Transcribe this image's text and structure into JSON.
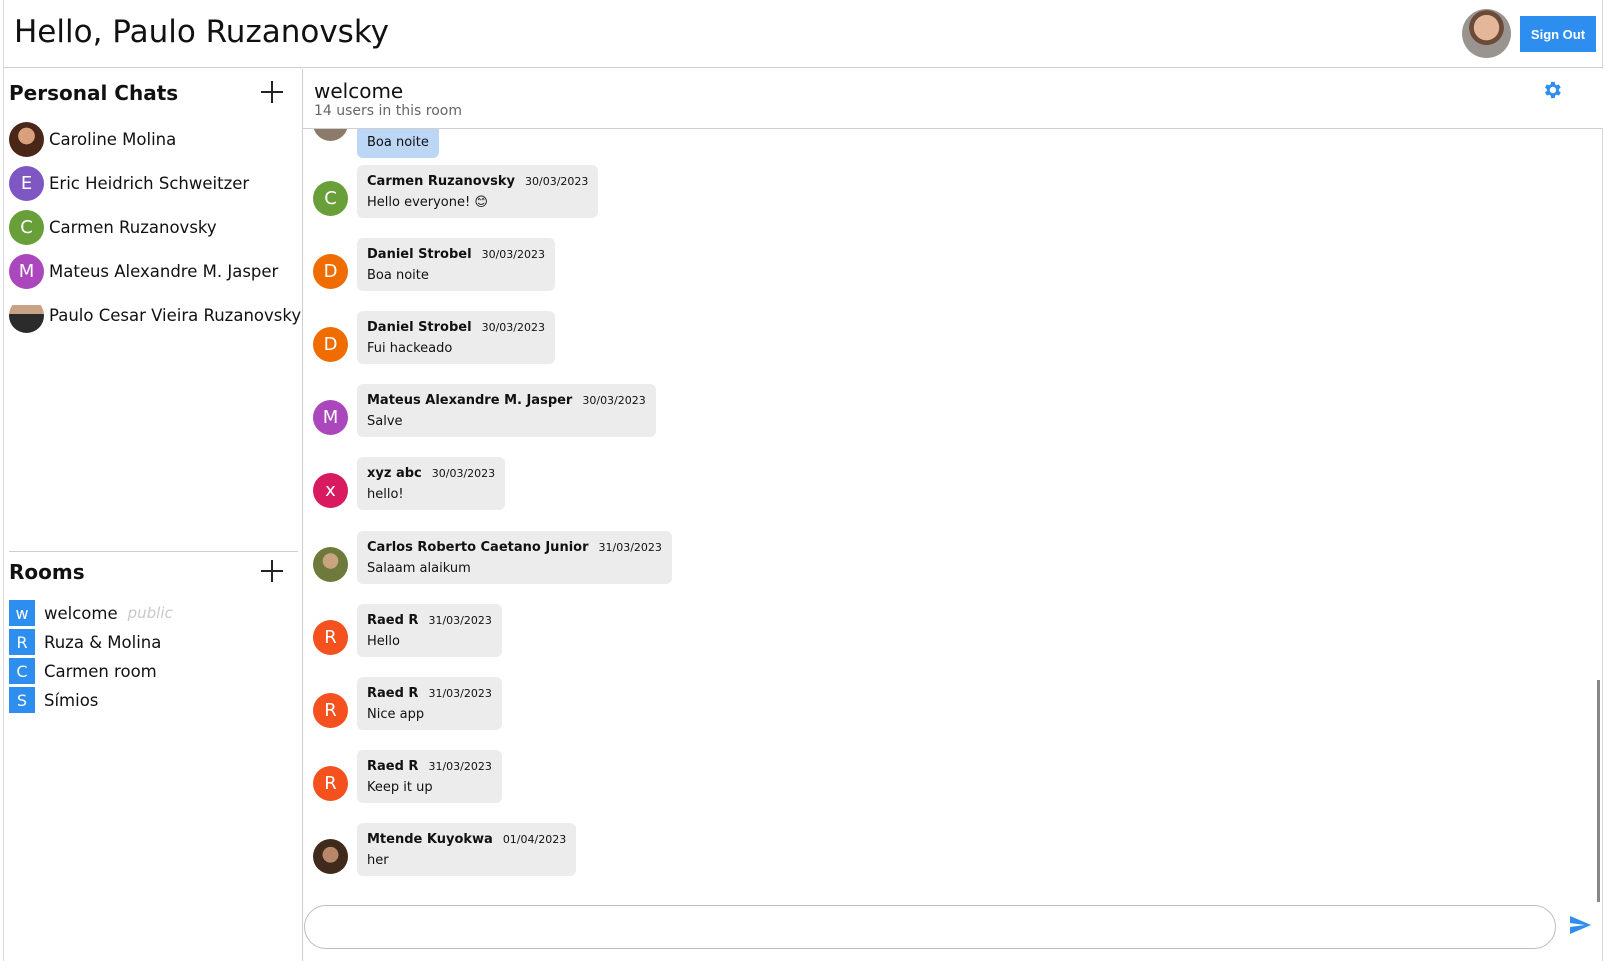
{
  "header": {
    "greeting": "Hello, Paulo Ruzanovsky",
    "signout_label": "Sign Out"
  },
  "personal_chats": {
    "title": "Personal Chats",
    "items": [
      {
        "name": "Caroline Molina",
        "initial": "",
        "color": "#6b3a2a",
        "photo": true
      },
      {
        "name": "Eric Heidrich Schweitzer",
        "initial": "E",
        "color": "#7e57c2"
      },
      {
        "name": "Carmen Ruzanovsky",
        "initial": "C",
        "color": "#689f38"
      },
      {
        "name": "Mateus Alexandre M. Jasper",
        "initial": "M",
        "color": "#ab47bc"
      },
      {
        "name": "Paulo Cesar Vieira Ruzanovsky",
        "initial": "",
        "color": "#3a3a3a",
        "photo": true
      }
    ]
  },
  "rooms": {
    "title": "Rooms",
    "items": [
      {
        "badge": "w",
        "name": "welcome",
        "tag": "public"
      },
      {
        "badge": "R",
        "name": "Ruza & Molina",
        "tag": ""
      },
      {
        "badge": "C",
        "name": "Carmen room",
        "tag": ""
      },
      {
        "badge": "S",
        "name": "Símios",
        "tag": ""
      }
    ]
  },
  "room": {
    "title": "welcome",
    "subtitle": "14 users in this room"
  },
  "messages": [
    {
      "author": "",
      "date": "",
      "text": "Boa noite",
      "initial": "",
      "color": "#8d7b6a",
      "mine": true
    },
    {
      "author": "Carmen Ruzanovsky",
      "date": "30/03/2023",
      "text": "Hello everyone! 😊",
      "initial": "C",
      "color": "#689f38"
    },
    {
      "author": "Daniel Strobel",
      "date": "30/03/2023",
      "text": "Boa noite",
      "initial": "D",
      "color": "#ef6c00"
    },
    {
      "author": "Daniel Strobel",
      "date": "30/03/2023",
      "text": "Fui hackeado",
      "initial": "D",
      "color": "#ef6c00"
    },
    {
      "author": "Mateus Alexandre M. Jasper",
      "date": "30/03/2023",
      "text": "Salve",
      "initial": "M",
      "color": "#ab47bc"
    },
    {
      "author": "xyz abc",
      "date": "30/03/2023",
      "text": "hello!",
      "initial": "x",
      "color": "#d81b60"
    },
    {
      "author": "Carlos Roberto Caetano Junior",
      "date": "31/03/2023",
      "text": "Salaam alaikum",
      "initial": "",
      "color": "#7a6a3c"
    },
    {
      "author": "Raed R",
      "date": "31/03/2023",
      "text": "Hello",
      "initial": "R",
      "color": "#f4511e"
    },
    {
      "author": "Raed R",
      "date": "31/03/2023",
      "text": "Nice app",
      "initial": "R",
      "color": "#f4511e"
    },
    {
      "author": "Raed R",
      "date": "31/03/2023",
      "text": "Keep it up",
      "initial": "R",
      "color": "#f4511e"
    },
    {
      "author": "Mtende Kuyokwa",
      "date": "01/04/2023",
      "text": "her",
      "initial": "",
      "color": "#4a3426"
    }
  ],
  "composer": {
    "placeholder": ""
  },
  "colors": {
    "accent": "#2d8ef0",
    "bubble": "#ececec",
    "own_bubble": "#bcd6f5"
  },
  "icons": {
    "add": "plus-icon",
    "settings": "gear-icon",
    "send": "send-icon"
  }
}
